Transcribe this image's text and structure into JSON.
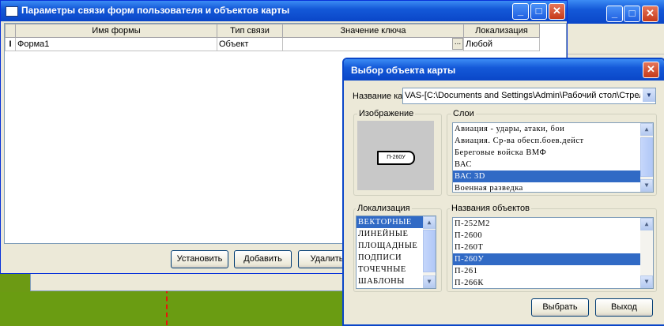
{
  "main_window": {
    "title": "Параметры связи форм пользователя и объектов карты",
    "columns": [
      "Имя формы",
      "Тип связи",
      "Значение ключа",
      "Локализация"
    ],
    "rows": [
      {
        "marker": "I",
        "name": "Форма1",
        "type": "Объект",
        "key": "",
        "loc": "Любой"
      }
    ],
    "ellipsis": "...",
    "buttons": {
      "install": "Установить",
      "add": "Добавить",
      "delete": "Удалить"
    }
  },
  "dialog": {
    "title": "Выбор объекта карты",
    "map_name_label": "Название ка",
    "map_name_value": "VAS-[C:\\Documents and Settings\\Admin\\Рабочий стол\\Стрел",
    "image_label": "Изображение",
    "image_caption": "П-260У",
    "layers_label": "Слои",
    "layers": [
      "Авиация - удары, атаки, бои",
      "Авиация. Ср-ва обесп.боев.дейст",
      "Береговые войска ВМФ",
      "ВАС",
      "ВАС 3D",
      "Военная разведка"
    ],
    "layers_selected": 4,
    "localization_label": "Локализация",
    "localizations": [
      "ВЕКТОРНЫЕ",
      "ЛИНЕЙНЫЕ",
      "ПЛОЩАДНЫЕ",
      "ПОДПИСИ",
      "ТОЧЕЧНЫЕ",
      "ШАБЛОНЫ"
    ],
    "localization_selected": 0,
    "objects_label": "Названия объектов",
    "objects": [
      "П-252М2",
      "П-2600",
      "П-260Т",
      "П-260У",
      "П-261",
      "П-266К"
    ],
    "objects_selected": 3,
    "select_button": "Выбрать",
    "exit_button": "Выход"
  },
  "icons": [
    "window-icon",
    "minimize-icon",
    "maximize-icon",
    "close-icon",
    "dropdown-icon",
    "scroll-up-icon",
    "scroll-down-icon"
  ]
}
